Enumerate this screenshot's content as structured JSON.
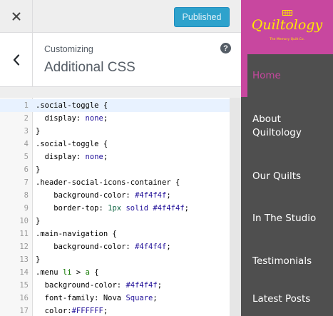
{
  "topbar": {
    "close_icon": "close-icon",
    "publish_label": "Published"
  },
  "section": {
    "back_icon": "chevron-left-icon",
    "customizing_label": "Customizing",
    "title": "Additional CSS",
    "help_icon": "help-icon",
    "help_label": "?"
  },
  "editor": {
    "active_line": 1,
    "lines": [
      {
        "num": "1",
        "tokens": [
          {
            "t": ".social-toggle {",
            "c": "t-prop"
          }
        ]
      },
      {
        "num": "2",
        "tokens": [
          {
            "t": "  display: ",
            "c": "t-prop"
          },
          {
            "t": "none",
            "c": "t-val"
          },
          {
            "t": ";",
            "c": "t-prop"
          }
        ]
      },
      {
        "num": "3",
        "tokens": [
          {
            "t": "}",
            "c": "t-prop"
          }
        ]
      },
      {
        "num": "4",
        "tokens": [
          {
            "t": ".social-toggle {",
            "c": "t-prop"
          }
        ]
      },
      {
        "num": "5",
        "tokens": [
          {
            "t": "  display: ",
            "c": "t-prop"
          },
          {
            "t": "none",
            "c": "t-val"
          },
          {
            "t": ";",
            "c": "t-prop"
          }
        ]
      },
      {
        "num": "6",
        "tokens": [
          {
            "t": "}",
            "c": "t-prop"
          }
        ]
      },
      {
        "num": "7",
        "tokens": [
          {
            "t": ".header-social-icons-container {",
            "c": "t-prop"
          }
        ]
      },
      {
        "num": "8",
        "tokens": [
          {
            "t": "    background-color: ",
            "c": "t-prop"
          },
          {
            "t": "#4f4f4f",
            "c": "t-val"
          },
          {
            "t": ";",
            "c": "t-prop"
          }
        ]
      },
      {
        "num": "9",
        "tokens": [
          {
            "t": "    border-top: ",
            "c": "t-prop"
          },
          {
            "t": "1px",
            "c": "t-num"
          },
          {
            "t": " ",
            "c": "t-prop"
          },
          {
            "t": "solid",
            "c": "t-val"
          },
          {
            "t": " ",
            "c": "t-prop"
          },
          {
            "t": "#4f4f4f",
            "c": "t-val"
          },
          {
            "t": ";",
            "c": "t-prop"
          }
        ]
      },
      {
        "num": "10",
        "tokens": [
          {
            "t": "}",
            "c": "t-prop"
          }
        ]
      },
      {
        "num": "11",
        "tokens": [
          {
            "t": ".main-navigation {",
            "c": "t-prop"
          }
        ]
      },
      {
        "num": "12",
        "tokens": [
          {
            "t": "    background-color: ",
            "c": "t-prop"
          },
          {
            "t": "#4f4f4f",
            "c": "t-val"
          },
          {
            "t": ";",
            "c": "t-prop"
          }
        ]
      },
      {
        "num": "13",
        "tokens": [
          {
            "t": "}",
            "c": "t-prop"
          }
        ]
      },
      {
        "num": "14",
        "tokens": [
          {
            "t": ".menu ",
            "c": "t-prop"
          },
          {
            "t": "li",
            "c": "t-tag"
          },
          {
            "t": " > ",
            "c": "t-prop"
          },
          {
            "t": "a",
            "c": "t-tag"
          },
          {
            "t": " {",
            "c": "t-prop"
          }
        ]
      },
      {
        "num": "15",
        "tokens": [
          {
            "t": "  background-color: ",
            "c": "t-prop"
          },
          {
            "t": "#4f4f4f",
            "c": "t-val"
          },
          {
            "t": ";",
            "c": "t-prop"
          }
        ]
      },
      {
        "num": "16",
        "tokens": [
          {
            "t": "  font-family: Nova ",
            "c": "t-prop"
          },
          {
            "t": "Square",
            "c": "t-kw"
          },
          {
            "t": ";",
            "c": "t-prop"
          }
        ]
      },
      {
        "num": "17",
        "tokens": [
          {
            "t": "  color:",
            "c": "t-prop"
          },
          {
            "t": "#FFFFFF",
            "c": "t-val"
          },
          {
            "t": ";",
            "c": "t-prop"
          }
        ]
      }
    ]
  },
  "preview": {
    "accent_color": "#c8479f",
    "nav_background": "#4f4f4f",
    "logo_color": "#ffe900",
    "logo_icon": "quilt-icon",
    "site_name": "Quiltology",
    "tagline": "The Memory Quilt Co.",
    "nav": [
      {
        "label": "Home",
        "current": true
      },
      {
        "label": "About\nQuiltology",
        "current": false
      },
      {
        "label": "Our Quilts",
        "current": false
      },
      {
        "label": "In The Studio",
        "current": false
      },
      {
        "label": "Testimonials",
        "current": false
      },
      {
        "label": "Latest Posts",
        "current": false
      }
    ]
  }
}
